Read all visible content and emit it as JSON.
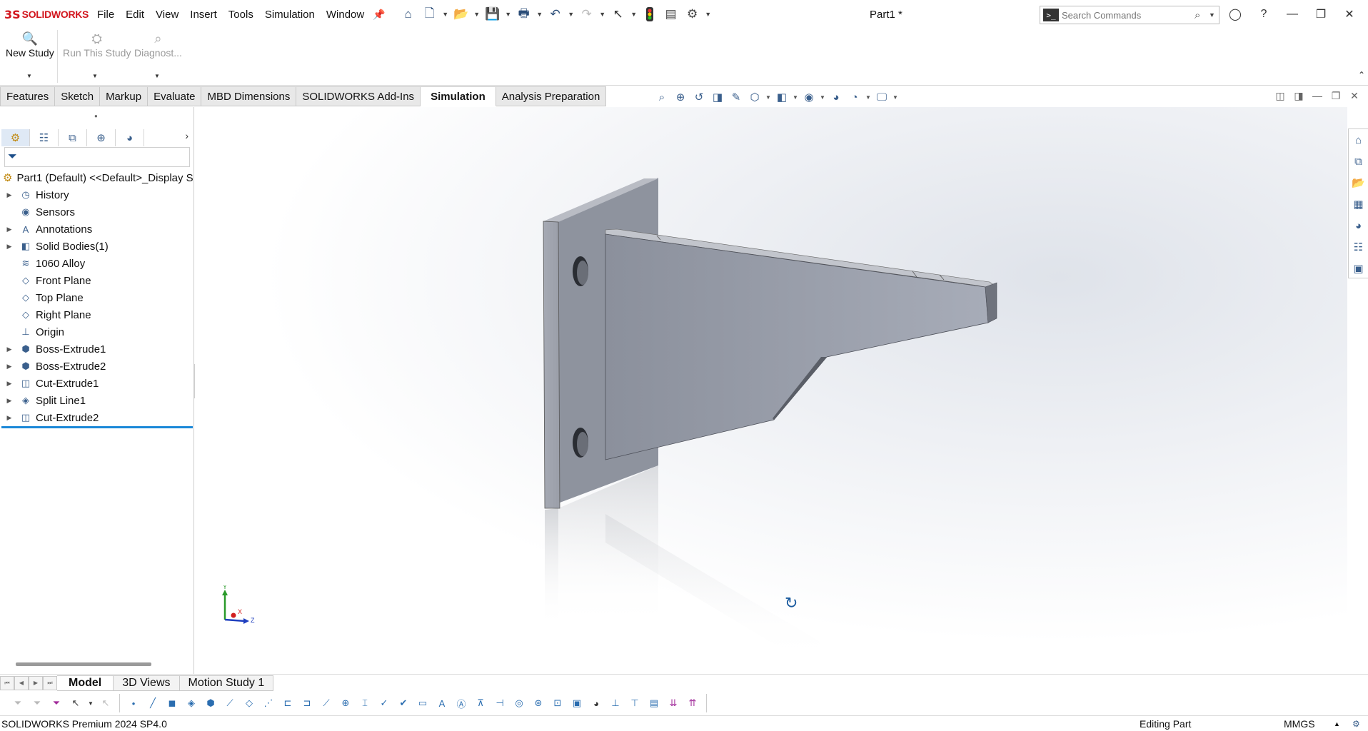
{
  "app": {
    "logo_mark": "3S",
    "logo_name": "SOLIDWORKS",
    "doc_title": "Part1 *"
  },
  "menu": [
    "File",
    "Edit",
    "View",
    "Insert",
    "Tools",
    "Simulation",
    "Window"
  ],
  "search": {
    "placeholder": "Search Commands"
  },
  "command_manager": {
    "new_study": "New Study",
    "run_study": "Run This Study",
    "diagnose": "Diagnost..."
  },
  "tabs": [
    "Features",
    "Sketch",
    "Markup",
    "Evaluate",
    "MBD Dimensions",
    "SOLIDWORKS Add-Ins",
    "Simulation",
    "Analysis Preparation"
  ],
  "active_tab": "Simulation",
  "tree": {
    "root": "Part1 (Default) <<Default>_Display S",
    "items": [
      {
        "label": "History",
        "icon": "history-icon",
        "expandable": true
      },
      {
        "label": "Sensors",
        "icon": "sensor-icon",
        "expandable": false
      },
      {
        "label": "Annotations",
        "icon": "annotation-icon",
        "expandable": true
      },
      {
        "label": "Solid Bodies(1)",
        "icon": "solid-bodies-icon",
        "expandable": true
      },
      {
        "label": "1060 Alloy",
        "icon": "material-icon",
        "expandable": false
      },
      {
        "label": "Front Plane",
        "icon": "plane-icon",
        "expandable": false
      },
      {
        "label": "Top Plane",
        "icon": "plane-icon",
        "expandable": false
      },
      {
        "label": "Right Plane",
        "icon": "plane-icon",
        "expandable": false
      },
      {
        "label": "Origin",
        "icon": "origin-icon",
        "expandable": false
      },
      {
        "label": "Boss-Extrude1",
        "icon": "extrude-icon",
        "expandable": true
      },
      {
        "label": "Boss-Extrude2",
        "icon": "extrude-icon",
        "expandable": true
      },
      {
        "label": "Cut-Extrude1",
        "icon": "cut-icon",
        "expandable": true
      },
      {
        "label": "Split Line1",
        "icon": "split-line-icon",
        "expandable": true
      },
      {
        "label": "Cut-Extrude2",
        "icon": "cut-icon",
        "expandable": true
      }
    ]
  },
  "triad": {
    "x": "X",
    "y": "Y",
    "z": "Z"
  },
  "bottom_tabs": [
    "Model",
    "3D Views",
    "Motion Study 1"
  ],
  "active_bottom_tab": "Model",
  "status": {
    "product": "SOLIDWORKS Premium 2024 SP4.0",
    "mode": "Editing Part",
    "units": "MMGS"
  },
  "colors": {
    "brand": "#d2161e",
    "selection": "#1a88d8",
    "active_tab_bg": "#ffffff"
  }
}
